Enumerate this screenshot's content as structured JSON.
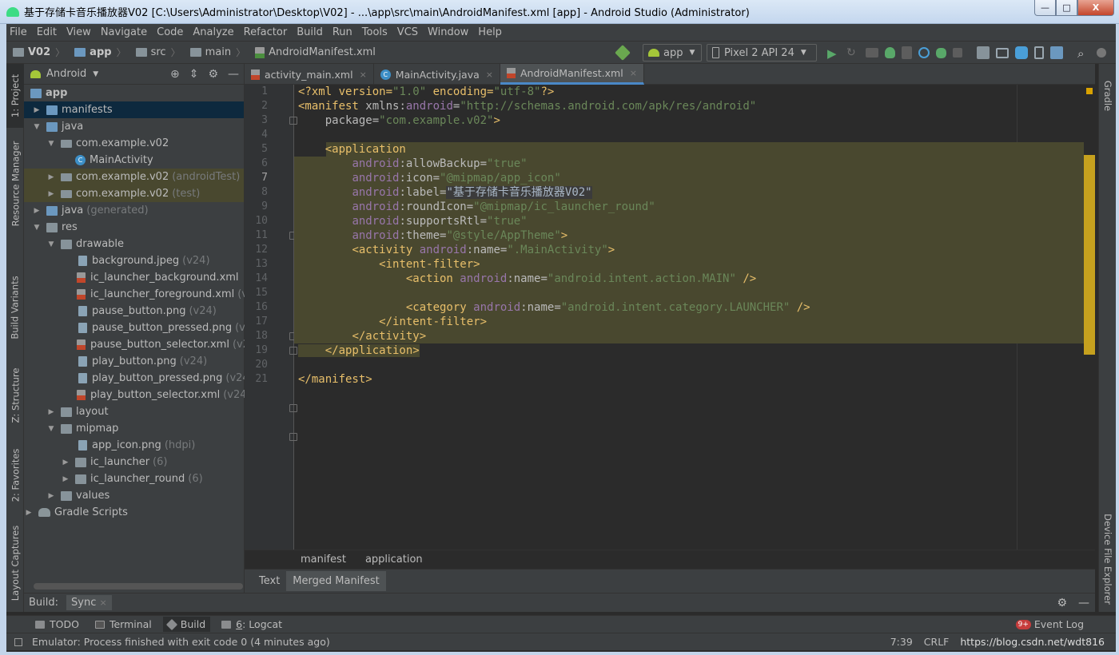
{
  "window": {
    "title": "基于存储卡音乐播放器V02 [C:\\Users\\Administrator\\Desktop\\V02] - ...\\app\\src\\main\\AndroidManifest.xml [app] - Android Studio (Administrator)",
    "min": "—",
    "max": "□",
    "close": "X"
  },
  "menu": [
    "File",
    "Edit",
    "View",
    "Navigate",
    "Code",
    "Analyze",
    "Refactor",
    "Build",
    "Run",
    "Tools",
    "VCS",
    "Window",
    "Help"
  ],
  "nav": {
    "crumbs": [
      "V02",
      "app",
      "src",
      "main",
      "AndroidManifest.xml"
    ],
    "run_config": "app",
    "device": "Pixel 2 API 24"
  },
  "left_tabs": [
    "1: Project",
    "Resource Manager",
    "Build Variants",
    "Z: Structure",
    "2: Favorites",
    "Layout Captures"
  ],
  "right_tabs": [
    "Gradle",
    "Device File Explorer"
  ],
  "project": {
    "view_mode": "Android",
    "tree": [
      {
        "name": "app",
        "extra": ""
      },
      {
        "name": "manifests",
        "extra": ""
      },
      {
        "name": "java",
        "extra": ""
      },
      {
        "name": "com.example.v02",
        "extra": ""
      },
      {
        "name": "MainActivity",
        "extra": ""
      },
      {
        "name": "com.example.v02",
        "extra": "(androidTest)"
      },
      {
        "name": "com.example.v02",
        "extra": "(test)"
      },
      {
        "name": "java",
        "extra": "(generated)"
      },
      {
        "name": "res",
        "extra": ""
      },
      {
        "name": "drawable",
        "extra": ""
      },
      {
        "name": "background.jpeg",
        "extra": "(v24)"
      },
      {
        "name": "ic_launcher_background.xml",
        "extra": ""
      },
      {
        "name": "ic_launcher_foreground.xml",
        "extra": "(v24)"
      },
      {
        "name": "pause_button.png",
        "extra": "(v24)"
      },
      {
        "name": "pause_button_pressed.png",
        "extra": "(v24)"
      },
      {
        "name": "pause_button_selector.xml",
        "extra": "(v24)"
      },
      {
        "name": "play_button.png",
        "extra": "(v24)"
      },
      {
        "name": "play_button_pressed.png",
        "extra": "(v24)"
      },
      {
        "name": "play_button_selector.xml",
        "extra": "(v24)"
      },
      {
        "name": "layout",
        "extra": ""
      },
      {
        "name": "mipmap",
        "extra": ""
      },
      {
        "name": "app_icon.png",
        "extra": "(hdpi)"
      },
      {
        "name": "ic_launcher",
        "extra": "(6)"
      },
      {
        "name": "ic_launcher_round",
        "extra": "(6)"
      },
      {
        "name": "values",
        "extra": ""
      },
      {
        "name": "Gradle Scripts",
        "extra": ""
      }
    ]
  },
  "editor_tabs": [
    {
      "label": "activity_main.xml",
      "close": "×"
    },
    {
      "label": "MainActivity.java",
      "close": "×"
    },
    {
      "label": "AndroidManifest.xml",
      "close": "×"
    }
  ],
  "line_numbers": [
    "1",
    "2",
    "3",
    "4",
    "5",
    "6",
    "7",
    "8",
    "9",
    "10",
    "11",
    "12",
    "13",
    "14",
    "15",
    "16",
    "17",
    "18",
    "19",
    "20",
    "21"
  ],
  "code": {
    "l1a": "<?xml version=",
    "l1b": "\"1.0\"",
    "l1c": " encoding=",
    "l1d": "\"utf-8\"",
    "l1e": "?>",
    "l2a": "<manifest ",
    "l2b": "xmlns:",
    "l2c": "android",
    "l2d": "=",
    "l2e": "\"http://schemas.android.com/apk/res/android\"",
    "l3a": "    package=",
    "l3b": "\"com.example.v02\"",
    "l3c": ">",
    "l5": "    <application",
    "l6a": "android",
    "l6b": ":allowBackup=",
    "l6c": "\"true\"",
    "l7a": "android",
    "l7b": ":icon=",
    "l7c": "\"@mipmap/app_icon\"",
    "l8a": "android",
    "l8b": ":label=",
    "l8c": "\"基于存储卡音乐播放器V02\"",
    "l9a": "android",
    "l9b": ":roundIcon=",
    "l9c": "\"@mipmap/ic_launcher_round\"",
    "l10a": "android",
    "l10b": ":supportsRtl=",
    "l10c": "\"true\"",
    "l11a": "android",
    "l11b": ":theme=",
    "l11c": "\"@style/AppTheme\"",
    "l11d": ">",
    "l12a": "<activity ",
    "l12b": "android",
    "l12c": ":name=",
    "l12d": "\".MainActivity\"",
    "l12e": ">",
    "l13": "<intent-filter>",
    "l14a": "<action ",
    "l14b": "android",
    "l14c": ":name=",
    "l14d": "\"android.intent.action.MAIN\"",
    "l14e": " />",
    "l16a": "<category ",
    "l16b": "android",
    "l16c": ":name=",
    "l16d": "\"android.intent.category.LAUNCHER\"",
    "l16e": " />",
    "l17": "</intent-filter>",
    "l18": "</activity>",
    "l19": "</application>",
    "l21": "</manifest>"
  },
  "editor_breadcrumb": [
    "manifest",
    "application"
  ],
  "editor_bottom_tabs": [
    "Text",
    "Merged Manifest"
  ],
  "build_panel": {
    "label": "Build:",
    "tab": "Sync",
    "close": "×"
  },
  "tool_windows": {
    "todo": "TODO",
    "terminal": "Terminal",
    "build": "Build",
    "logcat_num": "6",
    "logcat": ": Logcat",
    "event_badge": "9+",
    "event_log": "Event Log"
  },
  "status": {
    "message": "Emulator: Process finished with exit code 0 (4 minutes ago)",
    "position": "7:39",
    "line_sep": "CRLF",
    "watermark": "https://blog.csdn.net/wdt816"
  },
  "colors": {
    "bg_editor": "#2b2b2b",
    "bg_panel": "#3c3f41",
    "xml_tag": "#e8bf6a",
    "xml_value": "#6a8759",
    "xml_namespace": "#9876aa",
    "highlight": "#49482f",
    "selection": "#0d293e"
  }
}
